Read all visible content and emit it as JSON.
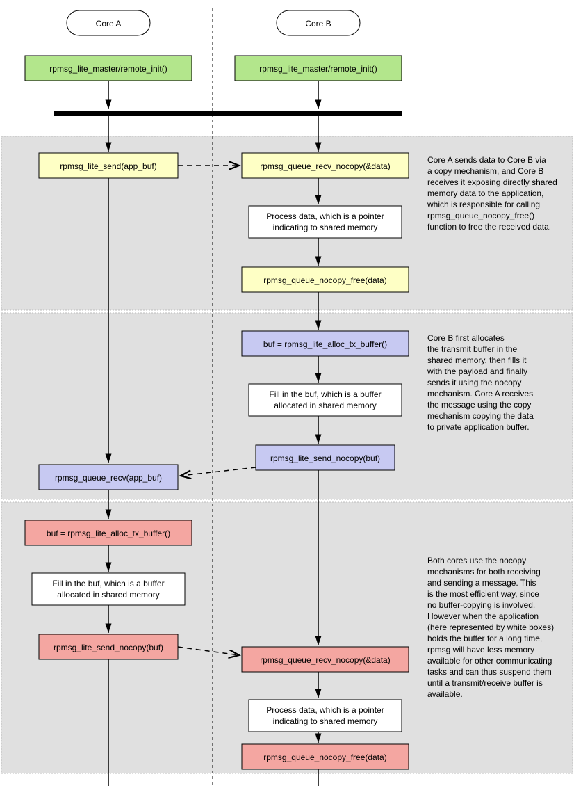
{
  "cores": {
    "a": "Core A",
    "b": "Core B"
  },
  "init": {
    "a": "rpmsg_lite_master/remote_init()",
    "b": "rpmsg_lite_master/remote_init()"
  },
  "section1": {
    "a_send": "rpmsg_lite_send(app_buf)",
    "b_recv": "rpmsg_queue_recv_nocopy(&data)",
    "b_process_l1": "Process data, which is a pointer",
    "b_process_l2": "indicating to shared memory",
    "b_free": "rpmsg_queue_nocopy_free(data)",
    "desc": [
      "Core A sends data to Core B via",
      "a copy mechanism, and Core B",
      "receives it exposing directly shared",
      "memory data to the application,",
      "which is responsible for calling",
      "rpmsg_queue_nocopy_free()",
      "function to free the received data."
    ]
  },
  "section2": {
    "b_alloc": "buf = rpmsg_lite_alloc_tx_buffer()",
    "b_fill_l1": "Fill in the buf, which is a buffer",
    "b_fill_l2": "allocated in shared memory",
    "b_send": "rpmsg_lite_send_nocopy(buf)",
    "a_recv": "rpmsg_queue_recv(app_buf)",
    "desc": [
      "Core B first allocates",
      "the transmit buffer in the",
      "shared memory, then fills it",
      "with the payload and finally",
      "sends it using the nocopy",
      "mechanism. Core A receives",
      "the message using the copy",
      "mechanism copying the data",
      "to private application buffer."
    ]
  },
  "section3": {
    "a_alloc": "buf = rpmsg_lite_alloc_tx_buffer()",
    "a_fill_l1": "Fill in the buf, which is a buffer",
    "a_fill_l2": "allocated in shared memory",
    "a_send": "rpmsg_lite_send_nocopy(buf)",
    "b_recv": "rpmsg_queue_recv_nocopy(&data)",
    "b_process_l1": "Process data, which is a pointer",
    "b_process_l2": "indicating to shared memory",
    "b_free": "rpmsg_queue_nocopy_free(data)",
    "desc": [
      "Both cores use the nocopy",
      "mechanisms for both receiving",
      "and sending a message. This",
      "is the most efficient way, since",
      "no buffer-copying is involved.",
      "However when the application",
      "(here represented by white boxes)",
      "holds the buffer for a long time,",
      "rpmsg will have less memory",
      "available for other communicating",
      "tasks and can thus suspend them",
      "until a transmit/receive buffer is",
      "available."
    ]
  },
  "colors": {
    "green": "#b3e68c",
    "yellow": "#feffc5",
    "blue": "#c7c9f2",
    "red": "#f4a6a1",
    "white": "#ffffff",
    "section_bg": "#e0e0e0",
    "section_stroke": "#bbbbbb"
  }
}
